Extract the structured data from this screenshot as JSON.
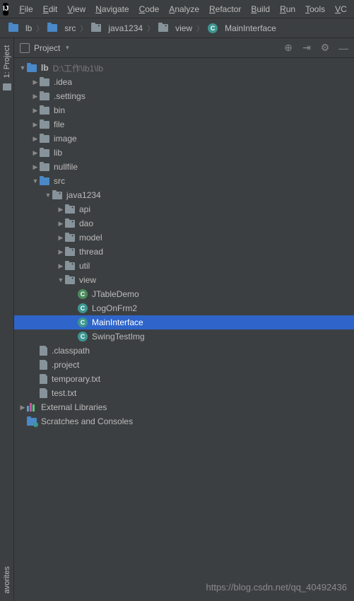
{
  "menu": {
    "items": [
      "File",
      "Edit",
      "View",
      "Navigate",
      "Code",
      "Analyze",
      "Refactor",
      "Build",
      "Run",
      "Tools",
      "VC"
    ]
  },
  "breadcrumbs": [
    {
      "label": "lb",
      "icon": "folder-blue"
    },
    {
      "label": "src",
      "icon": "folder-blue"
    },
    {
      "label": "java1234",
      "icon": "pkg"
    },
    {
      "label": "view",
      "icon": "pkg"
    },
    {
      "label": "MainInterface",
      "icon": "class-teal"
    }
  ],
  "sidebar": {
    "top_label": "1: Project",
    "bottom_label": "avorites"
  },
  "panel": {
    "title": "Project"
  },
  "tree": [
    {
      "d": 0,
      "arrow": "down",
      "icon": "folder-blue",
      "label": "lb",
      "bold": true,
      "hint": "D:\\工作\\lb1\\lb"
    },
    {
      "d": 1,
      "arrow": "right",
      "icon": "folder",
      "label": ".idea"
    },
    {
      "d": 1,
      "arrow": "right",
      "icon": "folder",
      "label": ".settings"
    },
    {
      "d": 1,
      "arrow": "right",
      "icon": "folder",
      "label": "bin"
    },
    {
      "d": 1,
      "arrow": "right",
      "icon": "folder",
      "label": "file"
    },
    {
      "d": 1,
      "arrow": "right",
      "icon": "folder",
      "label": "image"
    },
    {
      "d": 1,
      "arrow": "right",
      "icon": "folder",
      "label": "lib"
    },
    {
      "d": 1,
      "arrow": "right",
      "icon": "folder",
      "label": "nullfile"
    },
    {
      "d": 1,
      "arrow": "down",
      "icon": "folder-blue",
      "label": "src"
    },
    {
      "d": 2,
      "arrow": "down",
      "icon": "pkg",
      "label": "java1234"
    },
    {
      "d": 3,
      "arrow": "right",
      "icon": "pkg",
      "label": "api"
    },
    {
      "d": 3,
      "arrow": "right",
      "icon": "pkg",
      "label": "dao"
    },
    {
      "d": 3,
      "arrow": "right",
      "icon": "pkg",
      "label": "model"
    },
    {
      "d": 3,
      "arrow": "right",
      "icon": "pkg",
      "label": "thread"
    },
    {
      "d": 3,
      "arrow": "right",
      "icon": "pkg",
      "label": "util"
    },
    {
      "d": 3,
      "arrow": "down",
      "icon": "pkg",
      "label": "view"
    },
    {
      "d": 4,
      "arrow": "",
      "icon": "class-green",
      "label": "JTableDemo"
    },
    {
      "d": 4,
      "arrow": "",
      "icon": "class-teal",
      "label": "LogOnFrm2"
    },
    {
      "d": 4,
      "arrow": "",
      "icon": "class-teal",
      "label": "MainInterface",
      "selected": true
    },
    {
      "d": 4,
      "arrow": "",
      "icon": "class-teal",
      "label": "SwingTestImg"
    },
    {
      "d": 1,
      "arrow": "",
      "icon": "file",
      "label": ".classpath"
    },
    {
      "d": 1,
      "arrow": "",
      "icon": "file",
      "label": ".project"
    },
    {
      "d": 1,
      "arrow": "",
      "icon": "file",
      "label": "temporary.txt"
    },
    {
      "d": 1,
      "arrow": "",
      "icon": "file",
      "label": "test.txt"
    },
    {
      "d": 0,
      "arrow": "right",
      "icon": "lib",
      "label": "External Libraries"
    },
    {
      "d": 0,
      "arrow": "",
      "icon": "scratch",
      "label": "Scratches and Consoles"
    }
  ],
  "watermark": "https://blog.csdn.net/qq_40492436"
}
